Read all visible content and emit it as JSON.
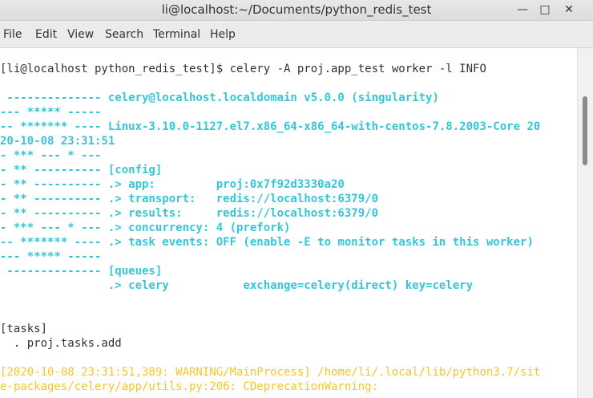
{
  "window": {
    "title": "li@localhost:~/Documents/python_redis_test",
    "buttons": {
      "minimize": "—",
      "maximize": "□",
      "close": "✕"
    }
  },
  "menu": [
    "File",
    "Edit",
    "View",
    "Search",
    "Terminal",
    "Help"
  ],
  "terminal": {
    "lines": [
      {
        "text": "[li@localhost python_redis_test]$ celery -A proj.app_test worker -l INFO",
        "style": "default"
      },
      {
        "text": "",
        "style": "default"
      },
      {
        "text": " -------------- celery@localhost.localdomain v5.0.0 (singularity)",
        "style": "cyan"
      },
      {
        "text": "--- ***** -----",
        "style": "cyan"
      },
      {
        "text": "-- ******* ---- Linux-3.10.0-1127.el7.x86_64-x86_64-with-centos-7.8.2003-Core 20",
        "style": "cyan"
      },
      {
        "text": "20-10-08 23:31:51",
        "style": "cyan"
      },
      {
        "text": "- *** --- * ---",
        "style": "cyan"
      },
      {
        "text": "- ** ---------- [config]",
        "style": "cyan"
      },
      {
        "text": "- ** ---------- .> app:         proj:0x7f92d3330a20",
        "style": "cyan"
      },
      {
        "text": "- ** ---------- .> transport:   redis://localhost:6379/0",
        "style": "cyan"
      },
      {
        "text": "- ** ---------- .> results:     redis://localhost:6379/0",
        "style": "cyan"
      },
      {
        "text": "- *** --- * --- .> concurrency: 4 (prefork)",
        "style": "cyan"
      },
      {
        "text": "-- ******* ---- .> task events: OFF (enable -E to monitor tasks in this worker)",
        "style": "cyan"
      },
      {
        "text": "--- ***** -----",
        "style": "cyan"
      },
      {
        "text": " -------------- [queues]",
        "style": "cyan"
      },
      {
        "text": "                .> celery           exchange=celery(direct) key=celery",
        "style": "cyan"
      },
      {
        "text": "",
        "style": "default"
      },
      {
        "text": "",
        "style": "default"
      },
      {
        "text": "[tasks]",
        "style": "default"
      },
      {
        "text": "  . proj.tasks.add",
        "style": "default"
      },
      {
        "text": "",
        "style": "default"
      },
      {
        "text": "[2020-10-08 23:31:51,389: WARNING/MainProcess] /home/li/.local/lib/python3.7/sit",
        "style": "yellow"
      },
      {
        "text": "e-packages/celery/app/utils.py:206: CDeprecationWarning:",
        "style": "yellow"
      }
    ]
  },
  "scrollbar": {
    "position_fraction": 0.0,
    "visible_fraction": 0.2
  }
}
